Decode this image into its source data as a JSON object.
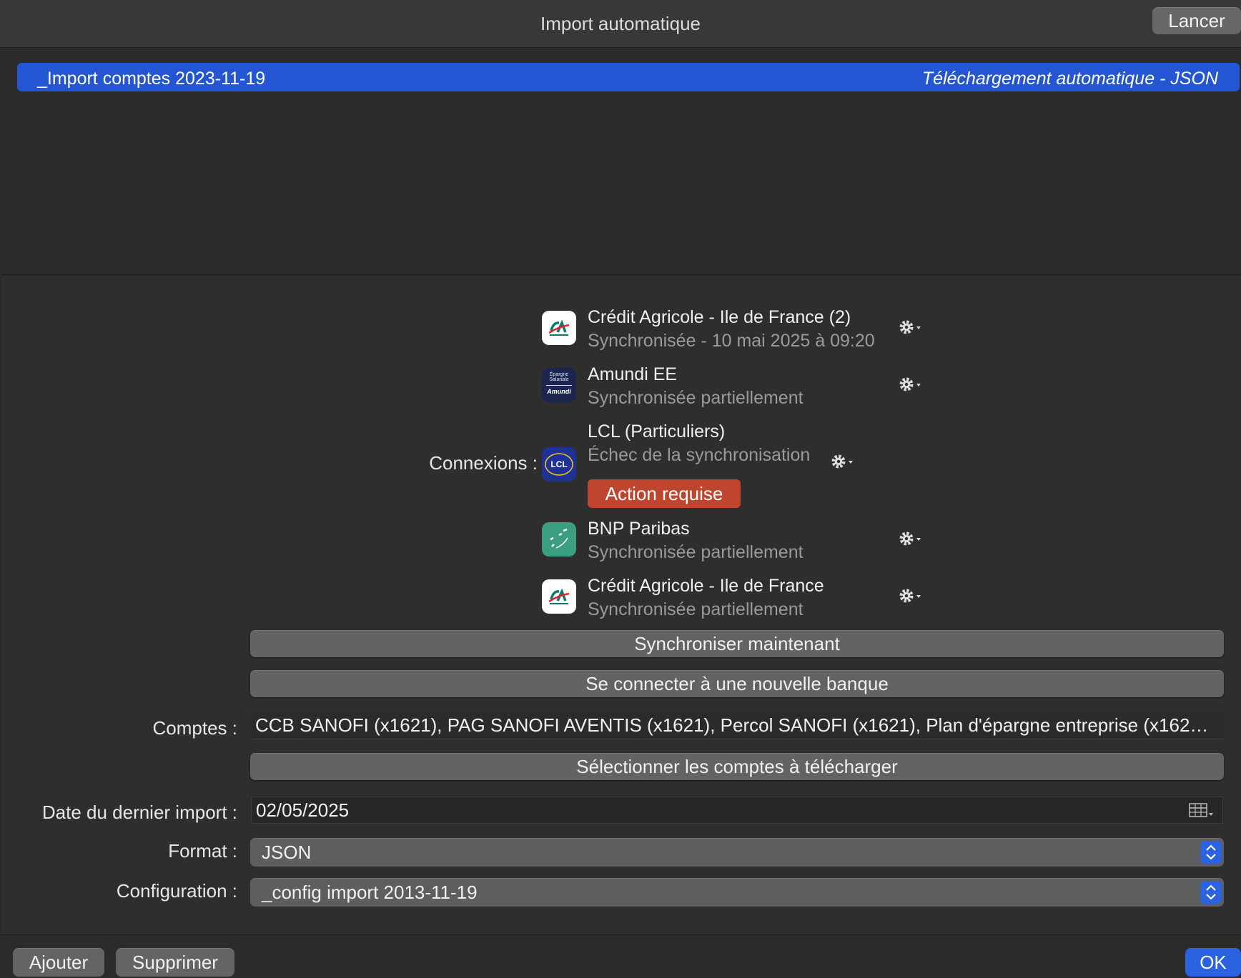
{
  "window": {
    "title": "Import automatique",
    "launch_button": "Lancer"
  },
  "import_list": {
    "items": [
      {
        "name": "_Import comptes 2023-11-19",
        "type": "Téléchargement automatique - JSON"
      }
    ]
  },
  "connections": {
    "label": "Connexions :",
    "items": [
      {
        "name": "Crédit Agricole - Ile de France (2)",
        "status": "Synchronisée - 10 mai 2025 à 09:20",
        "logo": "credit-agricole-logo"
      },
      {
        "name": "Amundi EE",
        "status": "Synchronisée partiellement",
        "logo": "amundi-logo",
        "logo_text": [
          "Épargne",
          "Salariale",
          "Amundi"
        ]
      },
      {
        "name": "LCL (Particuliers)",
        "status": "Échec de la synchronisation",
        "logo": "lcl-logo",
        "logo_text": "LCL",
        "badge": "Action requise"
      },
      {
        "name": "BNP Paribas",
        "status": "Synchronisée partiellement",
        "logo": "bnp-paribas-logo"
      },
      {
        "name": "Crédit Agricole - Ile de France",
        "status": "Synchronisée partiellement",
        "logo": "credit-agricole-logo"
      }
    ],
    "sync_now": "Synchroniser maintenant",
    "connect_bank": "Se connecter à une nouvelle banque"
  },
  "accounts": {
    "label": "Comptes :",
    "value": "CCB SANOFI (x1621), PAG SANOFI AVENTIS (x1621), Percol SANOFI (x1621), Plan d'épargne entreprise (x162…",
    "select_button": "Sélectionner les comptes à télécharger"
  },
  "last_import": {
    "label": "Date du dernier import :",
    "value": "02/05/2025"
  },
  "format": {
    "label": "Format :",
    "value": "JSON"
  },
  "configuration": {
    "label": "Configuration :",
    "value": "_config import 2013-11-19"
  },
  "footer": {
    "add": "Ajouter",
    "delete": "Supprimer",
    "ok": "OK"
  },
  "colors": {
    "selection": "#2456d4",
    "accent": "#2a62e0",
    "badge": "#c0452e"
  }
}
